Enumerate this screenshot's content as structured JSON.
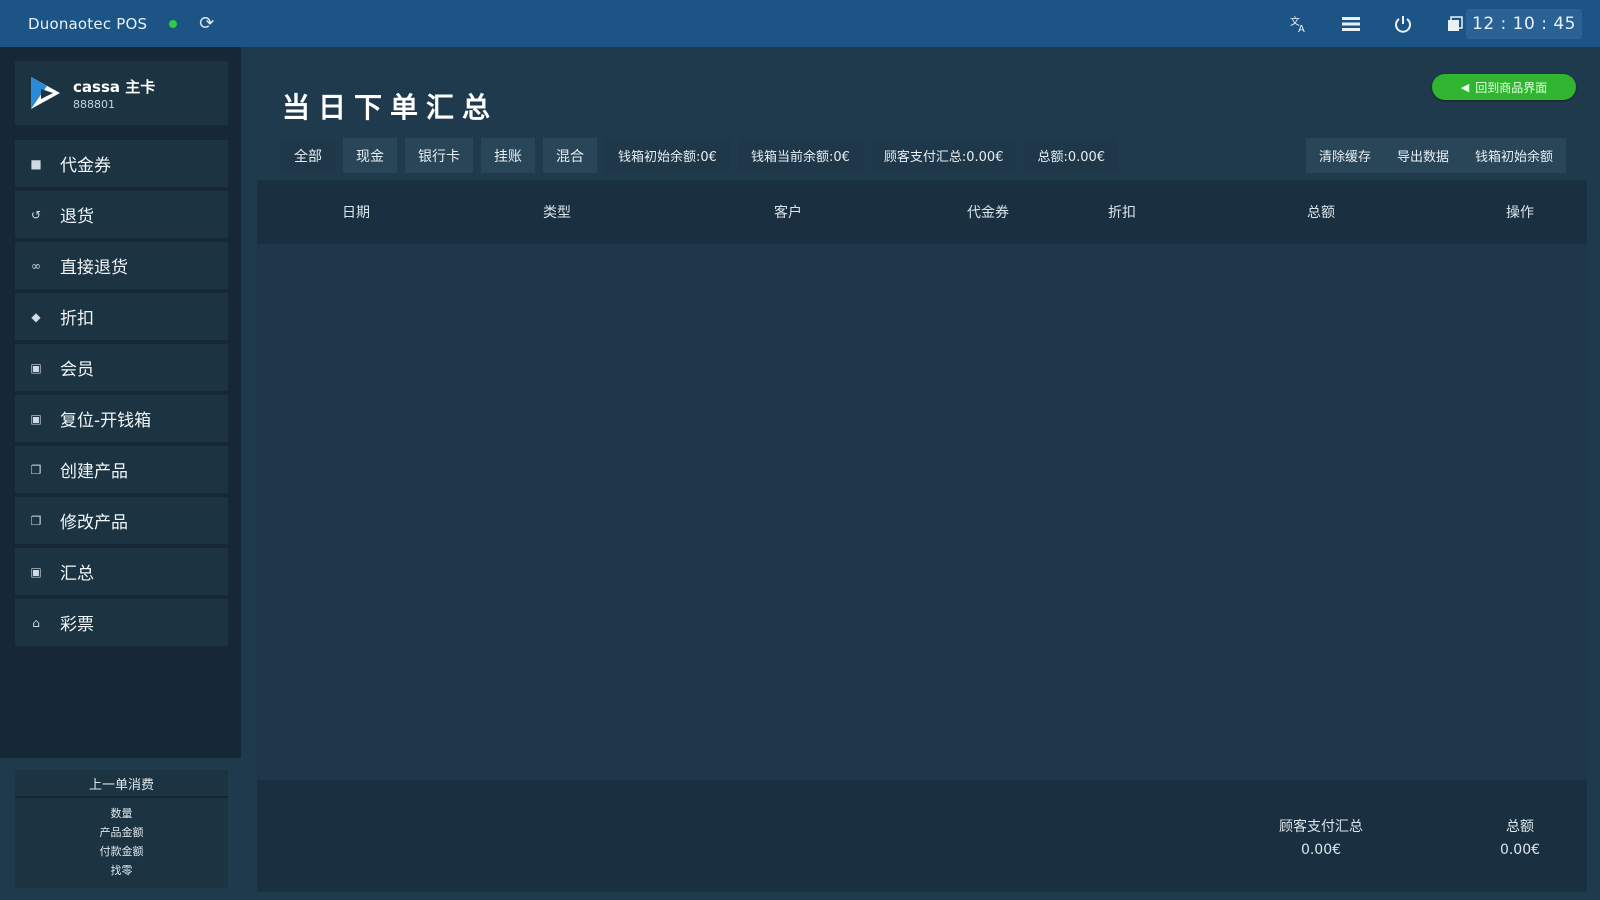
{
  "topbar": {
    "app_title": "Duonaotec POS",
    "status_color": "#2ecc40",
    "icons": [
      "refresh-icon",
      "translate-icon",
      "menu-icon",
      "power-icon",
      "window-icon"
    ],
    "clock": "12 : 10 : 45"
  },
  "user": {
    "name": "cassa 主卡",
    "id": "888801"
  },
  "sidebar": {
    "items": [
      {
        "label": "代金券",
        "icon": "square-icon"
      },
      {
        "label": "退货",
        "icon": "undo-icon"
      },
      {
        "label": "直接退货",
        "icon": "link-icon"
      },
      {
        "label": "折扣",
        "icon": "tag-icon"
      },
      {
        "label": "会员",
        "icon": "lock-icon"
      },
      {
        "label": "复位-开钱箱",
        "icon": "square-icon"
      },
      {
        "label": "创建产品",
        "icon": "copy-icon"
      },
      {
        "label": "修改产品",
        "icon": "copy-icon"
      },
      {
        "label": "汇总",
        "icon": "lock-icon"
      },
      {
        "label": "彩票",
        "icon": "home-icon"
      }
    ]
  },
  "last_order": {
    "title": "上一单消费",
    "lines": [
      "数量",
      "产品金额",
      "付款金额",
      "找零"
    ]
  },
  "main": {
    "title": "当日下单汇总",
    "back_button": "回到商品界面",
    "filters": [
      "全部",
      "现金",
      "银行卡",
      "挂账",
      "混合"
    ],
    "active_filter": "全部",
    "stats": [
      "钱箱初始余额:0€",
      "钱箱当前余额:0€",
      "顾客支付汇总:0.00€",
      "总额:0.00€"
    ],
    "actions": [
      "清除缓存",
      "导出数据",
      "钱箱初始余额"
    ],
    "columns": [
      "日期",
      "类型",
      "客户",
      "代金券",
      "折扣",
      "总额",
      "操作"
    ],
    "footer": {
      "customer_total_label": "顾客支付汇总",
      "customer_total_value": "0.00€",
      "total_label": "总额",
      "total_value": "0.00€"
    }
  },
  "colors": {
    "topbar": "#1b5485",
    "background": "#1f3a4d",
    "sidebar": "#162836",
    "accent_green": "#2fb52f"
  }
}
